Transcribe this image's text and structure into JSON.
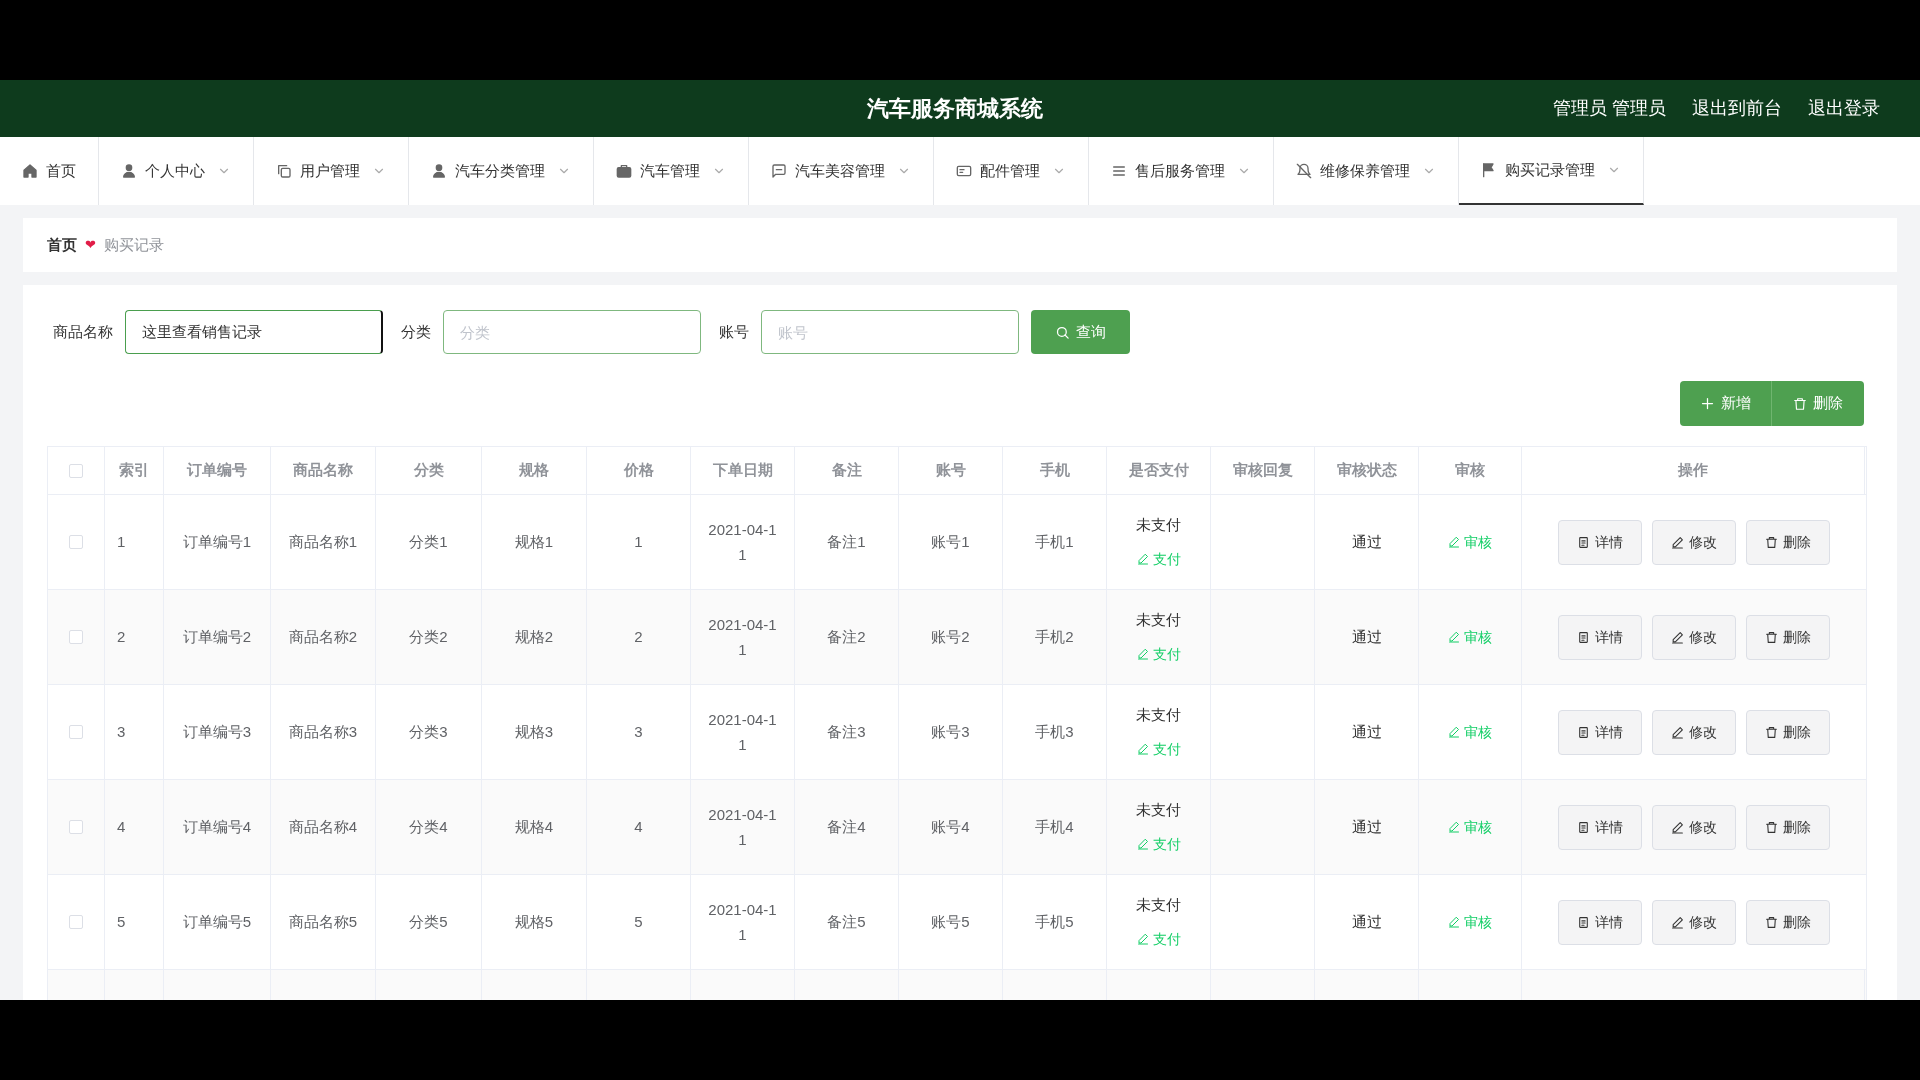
{
  "header": {
    "title": "汽车服务商城系统",
    "links": [
      "管理员 管理员",
      "退出到前台",
      "退出登录"
    ]
  },
  "nav": [
    {
      "label": "首页",
      "dropdown": false,
      "selected": false
    },
    {
      "label": "个人中心",
      "dropdown": true,
      "selected": false
    },
    {
      "label": "用户管理",
      "dropdown": true,
      "selected": false
    },
    {
      "label": "汽车分类管理",
      "dropdown": true,
      "selected": false
    },
    {
      "label": "汽车管理",
      "dropdown": true,
      "selected": false
    },
    {
      "label": "汽车美容管理",
      "dropdown": true,
      "selected": false
    },
    {
      "label": "配件管理",
      "dropdown": true,
      "selected": false
    },
    {
      "label": "售后服务管理",
      "dropdown": true,
      "selected": false
    },
    {
      "label": "维修保养管理",
      "dropdown": true,
      "selected": false
    },
    {
      "label": "购买记录管理",
      "dropdown": true,
      "selected": true
    }
  ],
  "breadcrumb": {
    "items": [
      "首页",
      "购买记录"
    ],
    "separator": "❤"
  },
  "search": {
    "fields": [
      {
        "label": "商品名称",
        "value": "这里查看销售记录"
      },
      {
        "label": "分类",
        "placeholder": "分类"
      },
      {
        "label": "账号",
        "placeholder": "账号"
      }
    ],
    "button": "查询"
  },
  "actions": [
    "新增",
    "删除"
  ],
  "table": {
    "header_checked": false,
    "columns": [
      "索引",
      "订单编号",
      "商品名称",
      "分类",
      "规格",
      "价格",
      "下单日期",
      "备注",
      "账号",
      "手机",
      "是否支付",
      "审核回复",
      "审核状态",
      "审核",
      "操作"
    ],
    "rows": [
      {
        "checked": false,
        "cells": [
          "1",
          "订单编号1",
          "商品名称1",
          "分类1",
          "规格1",
          "1",
          "2021-04-11",
          "备注1",
          "账号1",
          "手机1"
        ],
        "paid": "未支付",
        "pay": "支付",
        "status": "通过",
        "review": "审核",
        "ops": [
          "详情",
          "修改",
          "删除"
        ]
      },
      {
        "checked": false,
        "cells": [
          "2",
          "订单编号2",
          "商品名称2",
          "分类2",
          "规格2",
          "2",
          "2021-04-11",
          "备注2",
          "账号2",
          "手机2"
        ],
        "paid": "未支付",
        "pay": "支付",
        "status": "通过",
        "review": "审核",
        "ops": [
          "详情",
          "修改",
          "删除"
        ]
      },
      {
        "checked": false,
        "cells": [
          "3",
          "订单编号3",
          "商品名称3",
          "分类3",
          "规格3",
          "3",
          "2021-04-11",
          "备注3",
          "账号3",
          "手机3"
        ],
        "paid": "未支付",
        "pay": "支付",
        "status": "通过",
        "review": "审核",
        "ops": [
          "详情",
          "修改",
          "删除"
        ]
      },
      {
        "checked": false,
        "cells": [
          "4",
          "订单编号4",
          "商品名称4",
          "分类4",
          "规格4",
          "4",
          "2021-04-11",
          "备注4",
          "账号4",
          "手机4"
        ],
        "paid": "未支付",
        "pay": "支付",
        "status": "通过",
        "review": "审核",
        "ops": [
          "详情",
          "修改",
          "删除"
        ]
      },
      {
        "checked": false,
        "cells": [
          "5",
          "订单编号5",
          "商品名称5",
          "分类5",
          "规格5",
          "5",
          "2021-04-11",
          "备注5",
          "账号5",
          "手机5"
        ],
        "paid": "未支付",
        "pay": "支付",
        "status": "通过",
        "review": "审核",
        "ops": [
          "详情",
          "修改",
          "删除"
        ]
      }
    ]
  }
}
